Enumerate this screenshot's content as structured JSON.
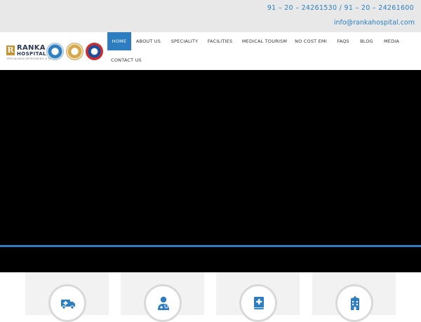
{
  "topbar": {
    "phones": "91 – 20 – 24261530 / 91 – 20 – 24261600",
    "email": "info@rankahospital.com"
  },
  "logo": {
    "letter": "R",
    "name": "RANKA",
    "sub": "HOSPITAL",
    "tagline": "SPECIALISED ORTHOPAEDIC & MORE"
  },
  "nav": {
    "items": [
      {
        "label": "HOME",
        "active": true
      },
      {
        "label": "ABOUT US"
      },
      {
        "label": "SPECIALITY"
      },
      {
        "label": "FACILITIES"
      },
      {
        "label": "MEDICAL TOURISM"
      },
      {
        "label": "NO COST EMI"
      },
      {
        "label": "FAQS"
      },
      {
        "label": "BLOG"
      },
      {
        "label": "MEDIA"
      },
      {
        "label": "CONTACT US"
      }
    ]
  },
  "colors": {
    "accent": "#2d7ec0",
    "topbar_bg": "#e8e8e8",
    "hero_bg": "#000000",
    "card_bg": "#f2f2f2"
  },
  "cards": [
    {
      "icon": "ambulance-icon"
    },
    {
      "icon": "doctor-icon"
    },
    {
      "icon": "medical-book-icon"
    },
    {
      "icon": "hospital-building-icon"
    }
  ]
}
